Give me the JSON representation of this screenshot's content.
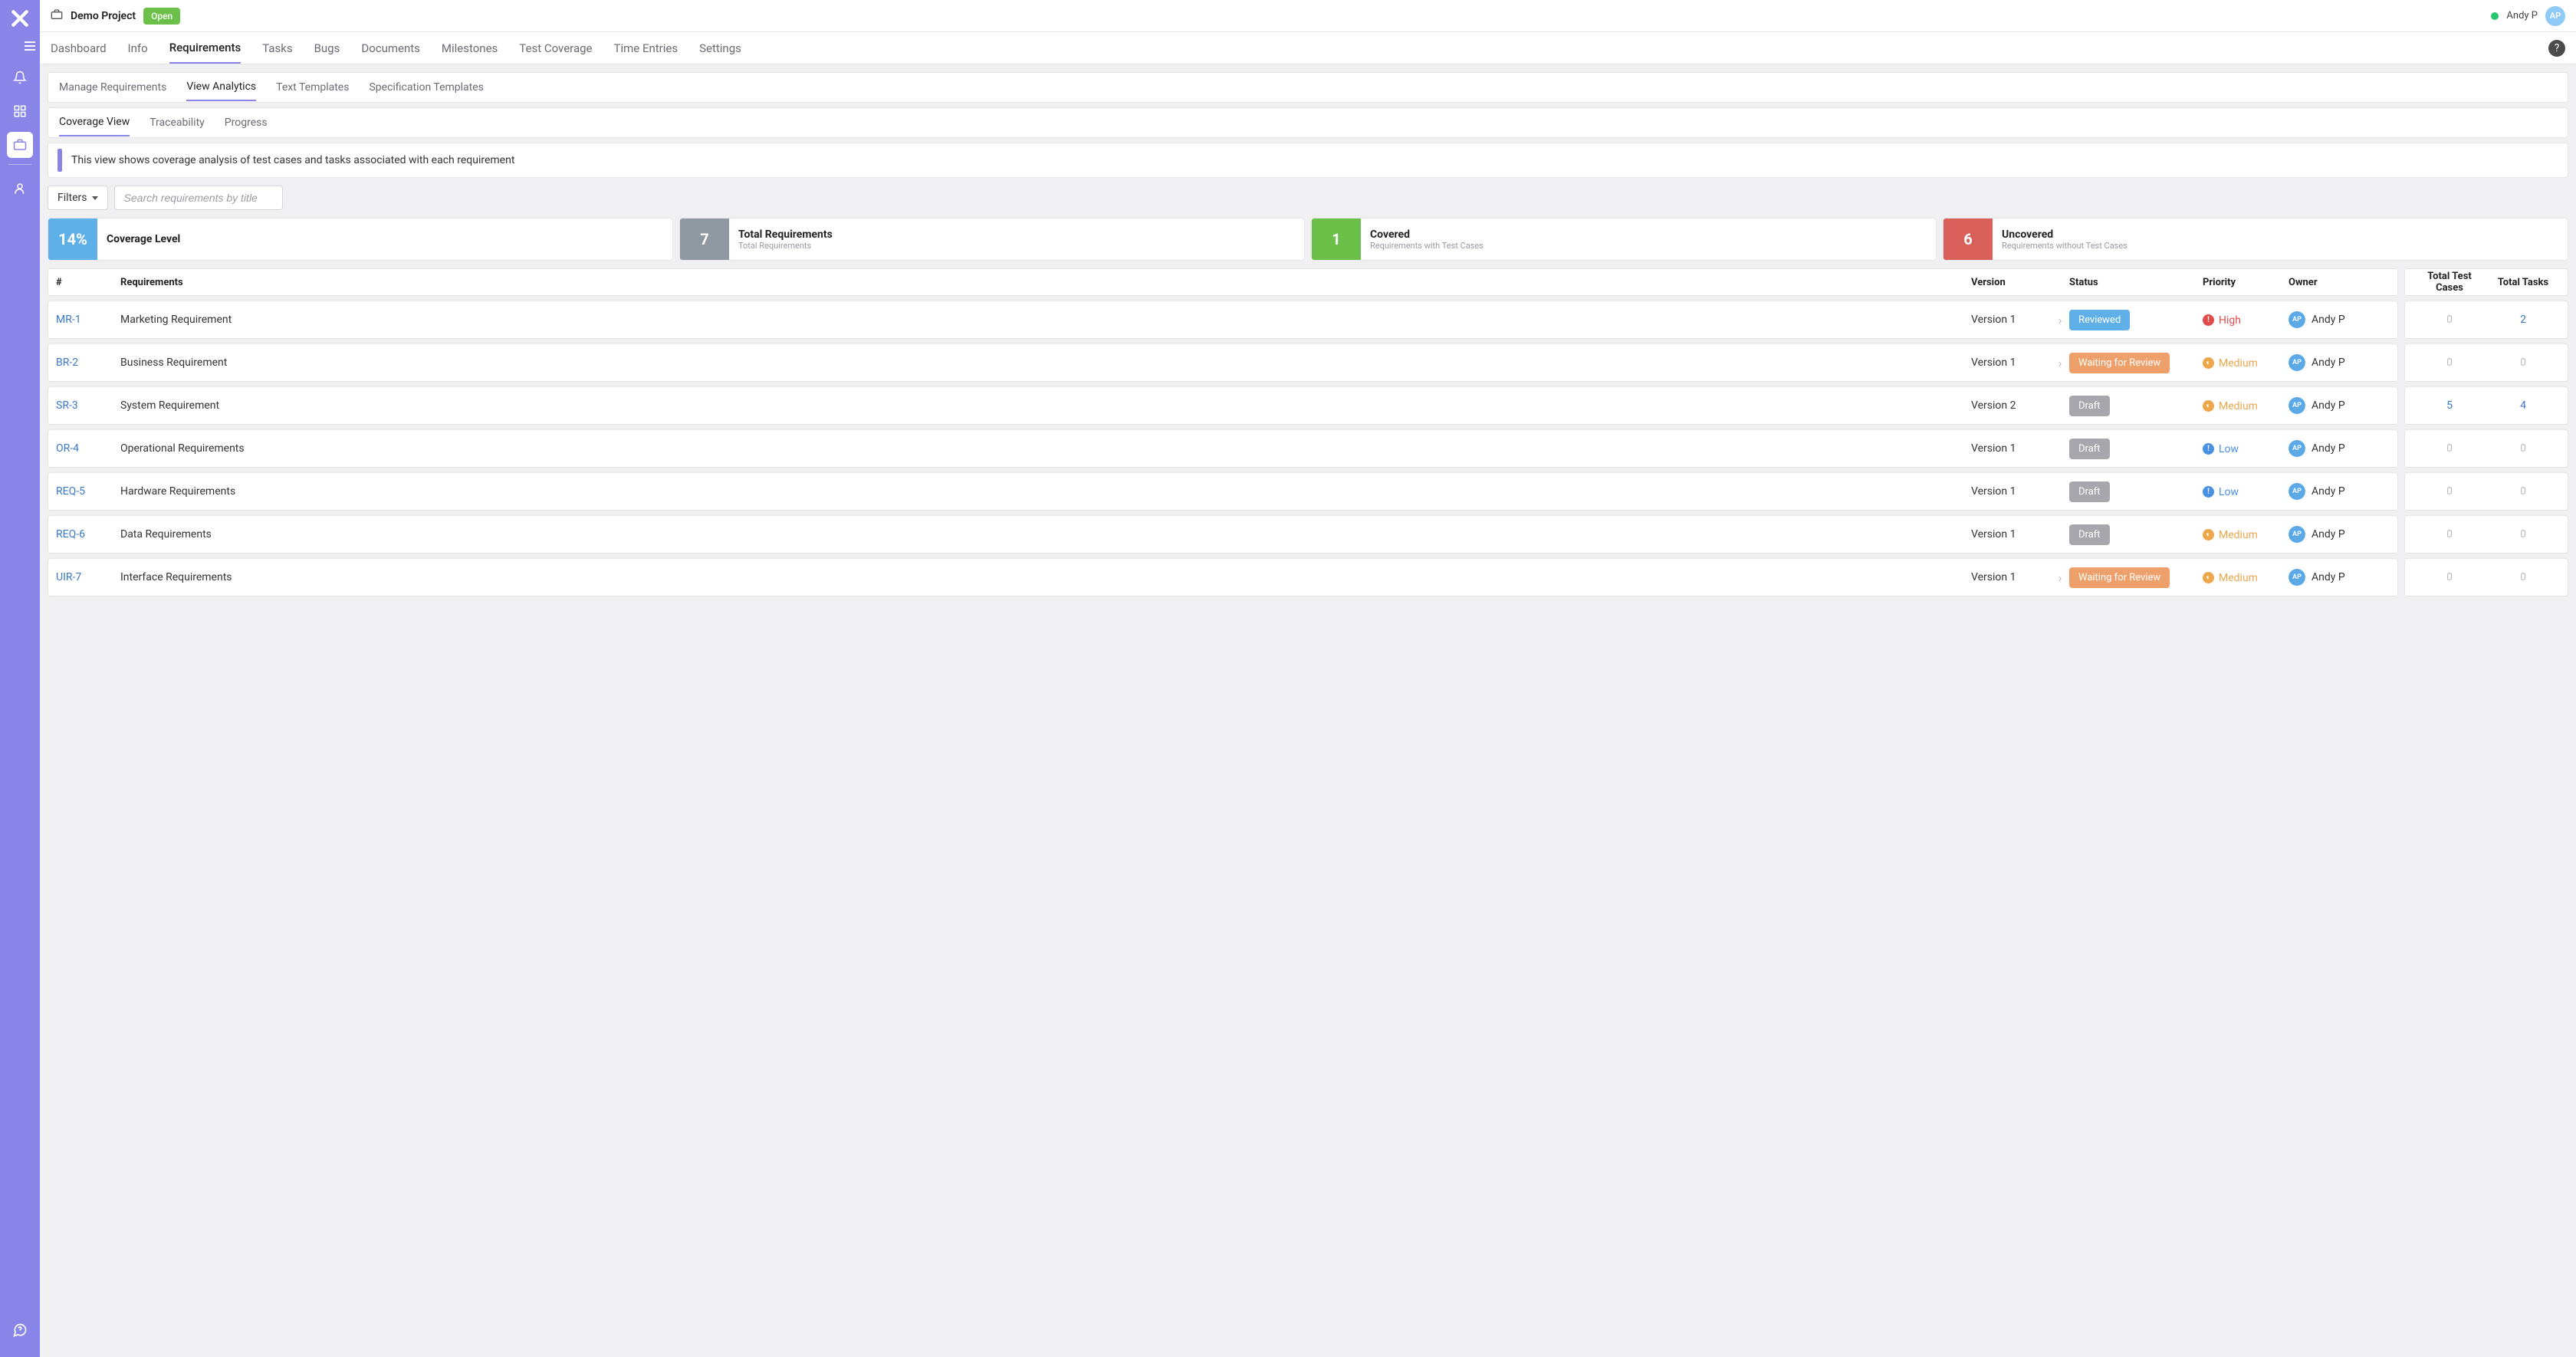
{
  "project": {
    "name": "Demo Project",
    "status": "Open"
  },
  "user": {
    "name": "Andy P",
    "initials": "AP"
  },
  "nav": {
    "tabs": [
      "Dashboard",
      "Info",
      "Requirements",
      "Tasks",
      "Bugs",
      "Documents",
      "Milestones",
      "Test Coverage",
      "Time Entries",
      "Settings"
    ],
    "active": "Requirements"
  },
  "subnav1": {
    "tabs": [
      "Manage Requirements",
      "View Analytics",
      "Text Templates",
      "Specification Templates"
    ],
    "active": "View Analytics"
  },
  "subnav2": {
    "tabs": [
      "Coverage View",
      "Traceability",
      "Progress"
    ],
    "active": "Coverage View"
  },
  "banner": "This view shows coverage analysis of test cases and tasks associated with each requirement",
  "filters": {
    "button": "Filters",
    "search_placeholder": "Search requirements by title"
  },
  "stats": {
    "coverage": {
      "box": "14%",
      "title": "Coverage Level",
      "sub": "",
      "color": "#5fb0e8"
    },
    "total": {
      "box": "7",
      "title": "Total Requirements",
      "sub": "Total Requirements",
      "color": "#8f97a0"
    },
    "covered": {
      "box": "1",
      "title": "Covered",
      "sub": "Requirements with Test Cases",
      "color": "#6cc04a"
    },
    "uncovered": {
      "box": "6",
      "title": "Uncovered",
      "sub": "Requirements without Test Cases",
      "color": "#d9605a"
    }
  },
  "columns": {
    "id": "#",
    "req": "Requirements",
    "ver": "Version",
    "stat": "Status",
    "pri": "Priority",
    "own": "Owner",
    "tc": "Total Test Cases",
    "tt": "Total Tasks"
  },
  "status_colors": {
    "Reviewed": "#5fb0e8",
    "Waiting for Review": "#eea06a",
    "Draft": "#a7a7ad"
  },
  "priority_meta": {
    "High": {
      "color": "#e24b4b",
      "icon": "!"
    },
    "Medium": {
      "color": "#eea64a",
      "icon": "◐"
    },
    "Low": {
      "color": "#4a90e2",
      "icon": "!"
    }
  },
  "rows": [
    {
      "id": "MR-1",
      "title": "Marketing Requirement",
      "version": "Version 1",
      "expand": true,
      "status": "Reviewed",
      "priority": "High",
      "owner": "Andy P",
      "tc": "0",
      "tt": "2",
      "tc_link": false,
      "tt_link": true
    },
    {
      "id": "BR-2",
      "title": "Business Requirement",
      "version": "Version 1",
      "expand": true,
      "status": "Waiting for Review",
      "priority": "Medium",
      "owner": "Andy P",
      "tc": "0",
      "tt": "0",
      "tc_link": false,
      "tt_link": false
    },
    {
      "id": "SR-3",
      "title": "System Requirement",
      "version": "Version 2",
      "expand": false,
      "status": "Draft",
      "priority": "Medium",
      "owner": "Andy P",
      "tc": "5",
      "tt": "4",
      "tc_link": true,
      "tt_link": true
    },
    {
      "id": "OR-4",
      "title": "Operational Requirements",
      "version": "Version 1",
      "expand": false,
      "status": "Draft",
      "priority": "Low",
      "owner": "Andy P",
      "tc": "0",
      "tt": "0",
      "tc_link": false,
      "tt_link": false
    },
    {
      "id": "REQ-5",
      "title": "Hardware Requirements",
      "version": "Version 1",
      "expand": false,
      "status": "Draft",
      "priority": "Low",
      "owner": "Andy P",
      "tc": "0",
      "tt": "0",
      "tc_link": false,
      "tt_link": false
    },
    {
      "id": "REQ-6",
      "title": "Data Requirements",
      "version": "Version 1",
      "expand": false,
      "status": "Draft",
      "priority": "Medium",
      "owner": "Andy P",
      "tc": "0",
      "tt": "0",
      "tc_link": false,
      "tt_link": false
    },
    {
      "id": "UIR-7",
      "title": "Interface Requirements",
      "version": "Version 1",
      "expand": true,
      "status": "Waiting for Review",
      "priority": "Medium",
      "owner": "Andy P",
      "tc": "0",
      "tt": "0",
      "tc_link": false,
      "tt_link": false
    }
  ]
}
